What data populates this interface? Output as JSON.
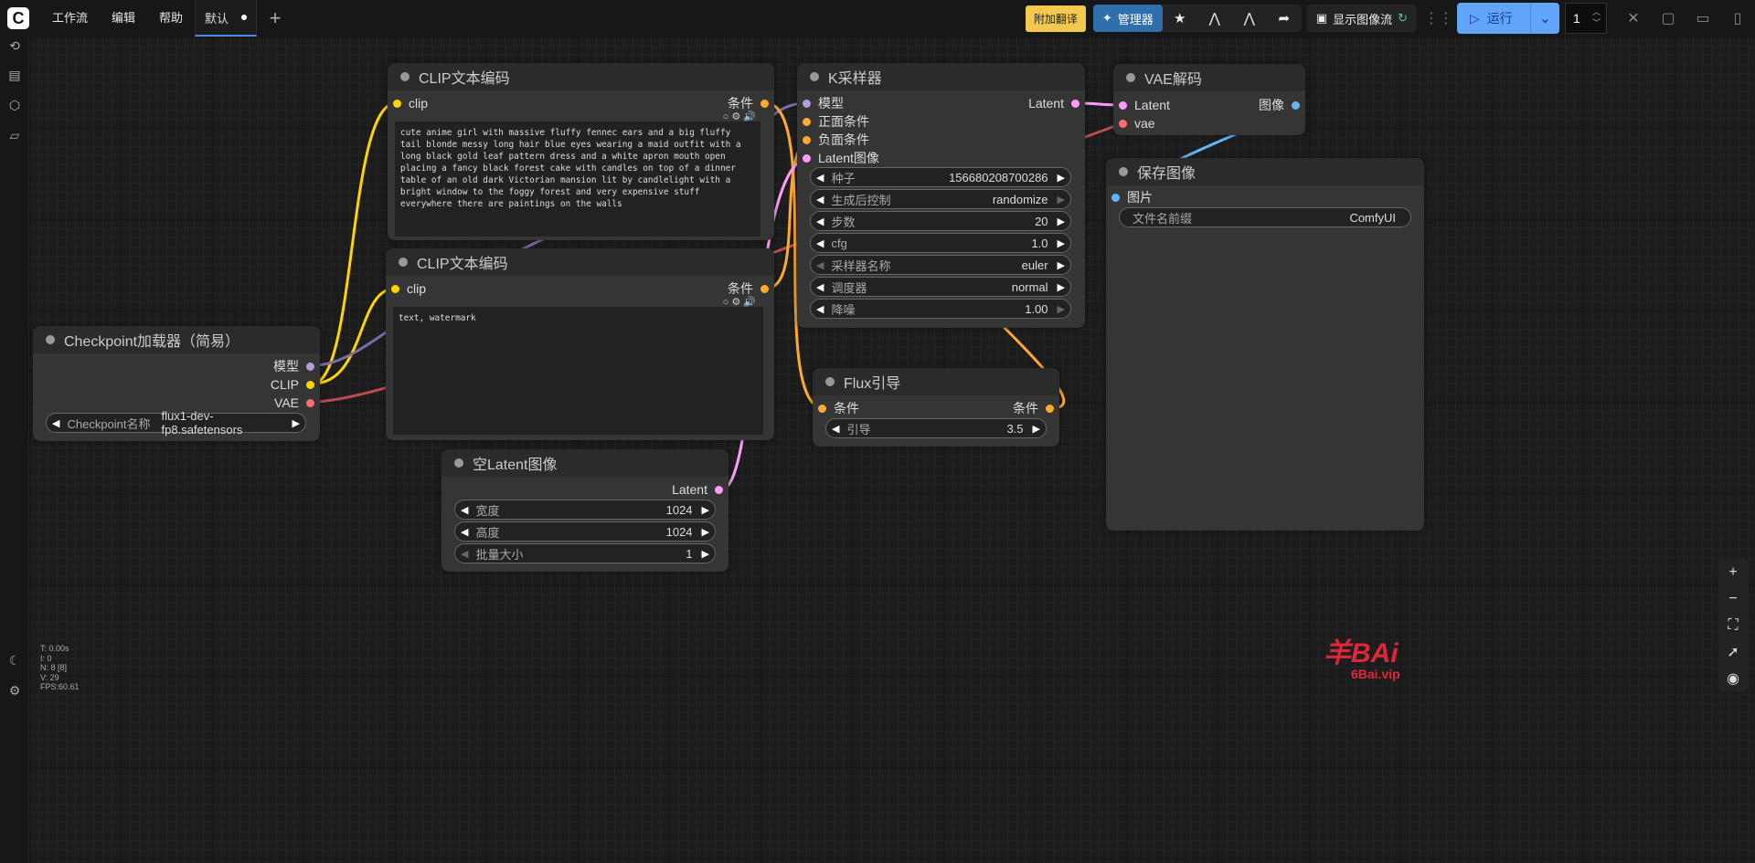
{
  "topbar": {
    "menu": [
      "工作流",
      "编辑",
      "帮助"
    ],
    "tab_label": "默认",
    "translate_label": "附加翻译",
    "manager_label": "管理器",
    "show_image_label": "显示图像流",
    "run_label": "运行",
    "batch_count": "1"
  },
  "nodes": {
    "clip1": {
      "title": "CLIP文本编码",
      "input": "clip",
      "output": "条件",
      "text": "cute anime girl with massive fluffy fennec ears and a big fluffy tail blonde messy long hair blue eyes wearing a maid outfit with a long black gold leaf pattern dress and a white apron mouth open placing a fancy black forest cake with candles on top of a dinner table of an old dark Victorian mansion lit by candlelight with a bright window to the foggy forest and very expensive stuff everywhere there are paintings on the walls"
    },
    "clip2": {
      "title": "CLIP文本编码",
      "input": "clip",
      "output": "条件",
      "text": "text, watermark"
    },
    "ksampler": {
      "title": "K采样器",
      "inputs": [
        "模型",
        "正面条件",
        "负面条件",
        "Latent图像"
      ],
      "output": "Latent",
      "widgets": [
        {
          "label": "种子",
          "value": "156680208700286"
        },
        {
          "label": "生成后控制",
          "value": "randomize"
        },
        {
          "label": "步数",
          "value": "20"
        },
        {
          "label": "cfg",
          "value": "1.0"
        },
        {
          "label": "采样器名称",
          "value": "euler"
        },
        {
          "label": "调度器",
          "value": "normal"
        },
        {
          "label": "降噪",
          "value": "1.00"
        }
      ]
    },
    "vae": {
      "title": "VAE解码",
      "inputs": [
        "Latent",
        "vae"
      ],
      "output": "图像"
    },
    "save": {
      "title": "保存图像",
      "input": "图片",
      "widget_label": "文件名前缀",
      "widget_value": "ComfyUI"
    },
    "checkpoint": {
      "title": "Checkpoint加载器（简易）",
      "outputs": [
        "模型",
        "CLIP",
        "VAE"
      ],
      "widget_label": "Checkpoint名称",
      "widget_value": "flux1-dev-fp8.safetensors"
    },
    "latent": {
      "title": "空Latent图像",
      "output": "Latent",
      "widgets": [
        {
          "label": "宽度",
          "value": "1024"
        },
        {
          "label": "高度",
          "value": "1024"
        },
        {
          "label": "批量大小",
          "value": "1"
        }
      ]
    },
    "flux": {
      "title": "Flux引导",
      "input": "条件",
      "output": "条件",
      "widget_label": "引导",
      "widget_value": "3.5"
    }
  },
  "stats": [
    "T: 0.00s",
    "I: 0",
    "N: 8 [8]",
    "V: 29",
    "FPS:60.61"
  ],
  "watermark": {
    "main": "羊BAi",
    "sub": "6Bai.vip"
  },
  "colors": {
    "clip": "#ffd500",
    "conditioning": "#ffa931",
    "model": "#b39ddb",
    "vae": "#ff6e6e",
    "latent": "#ff9cf9",
    "image": "#64b5f6"
  }
}
